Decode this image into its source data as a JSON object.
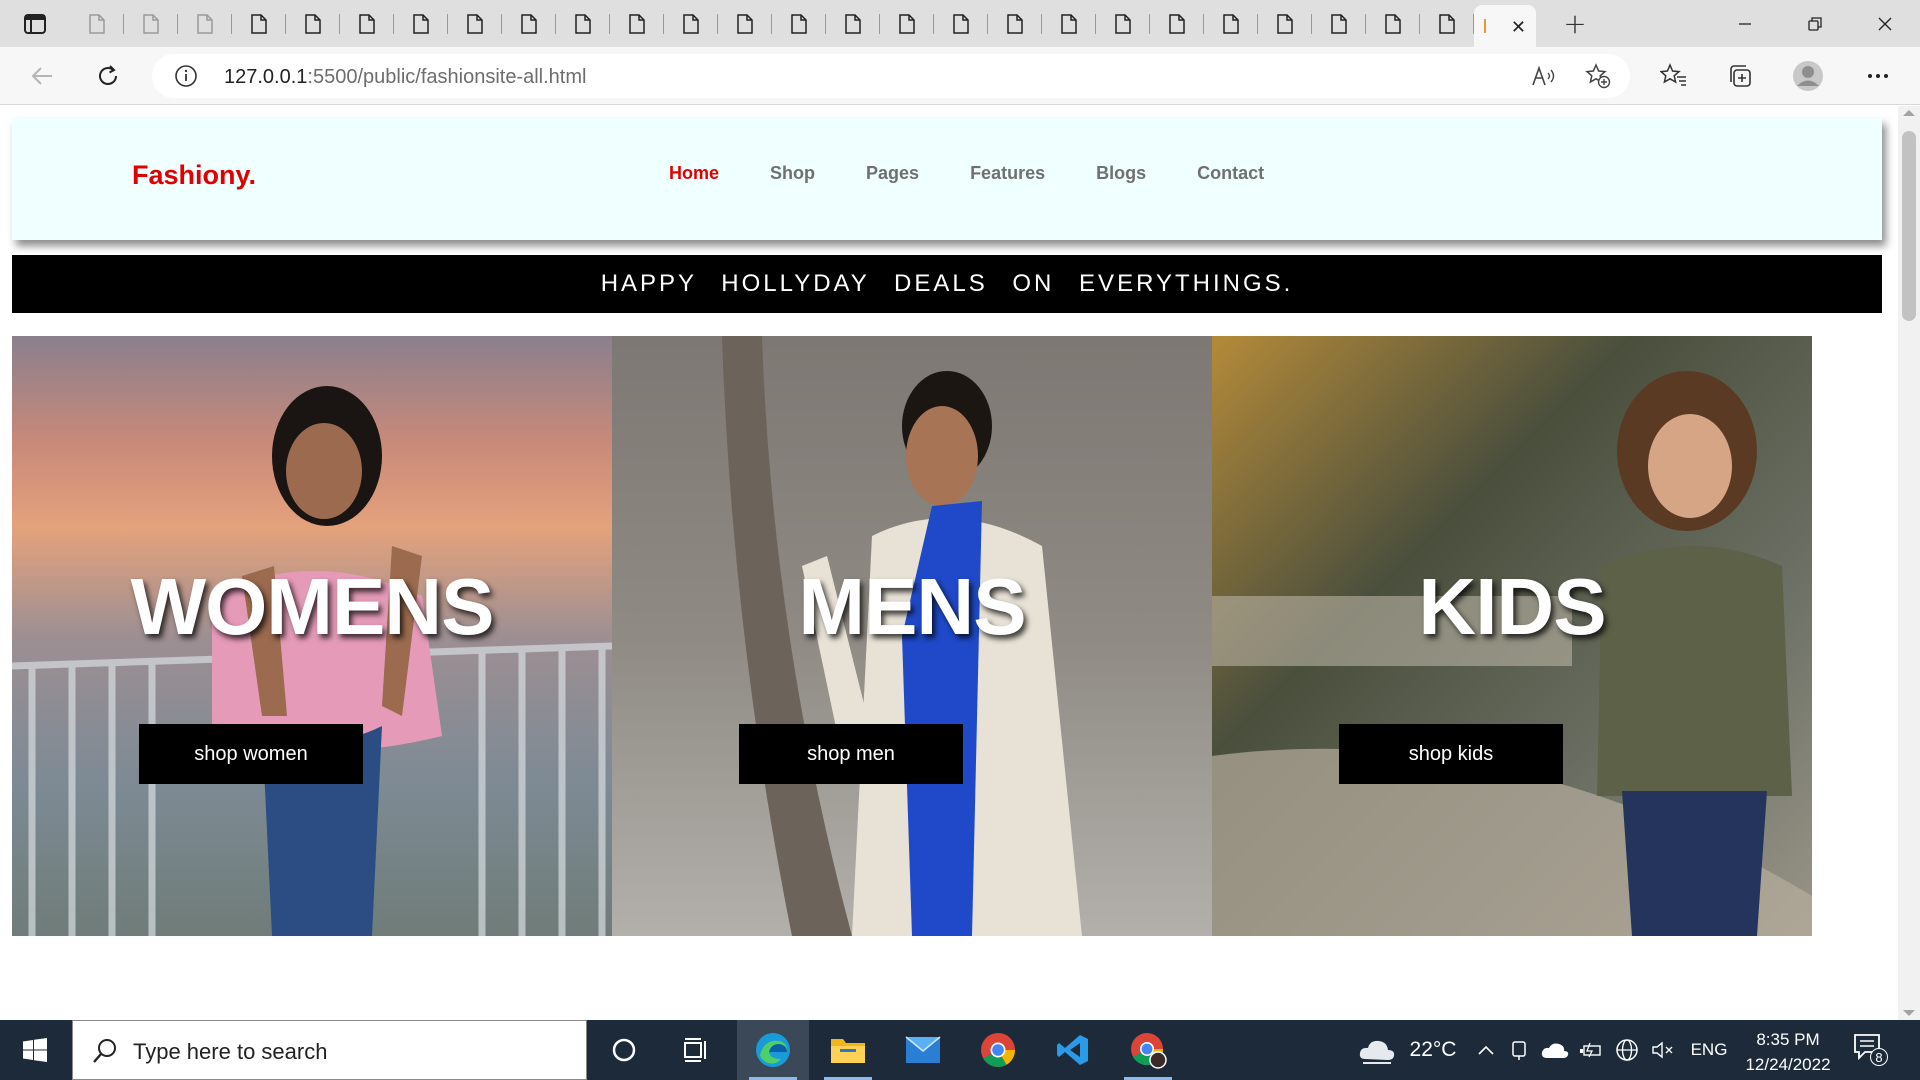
{
  "browser": {
    "tab_count_icons": 26,
    "active_tab_close": "✕",
    "url_host": "127.0.0.1",
    "url_path": ":5500/public/fashionsite-all.html"
  },
  "site": {
    "logo": "Fashiony.",
    "nav": [
      {
        "label": "Home",
        "current": true
      },
      {
        "label": "Shop"
      },
      {
        "label": "Pages"
      },
      {
        "label": "Features"
      },
      {
        "label": "Blogs"
      },
      {
        "label": "Contact"
      }
    ],
    "promo": "HAPPY HOLLYDAY DEALS ON EVERYTHINGS.",
    "categories": [
      {
        "title": "WOMENS",
        "button": "shop women"
      },
      {
        "title": "MENS",
        "button": "shop men"
      },
      {
        "title": "KIDS",
        "button": "shop kids"
      }
    ],
    "colors": {
      "accent": "#e10000",
      "header_bg": "#f0ffff",
      "banner_bg": "#000000"
    }
  },
  "taskbar": {
    "search_placeholder": "Type here to search",
    "weather_temp": "22°C",
    "language": "ENG",
    "time": "8:35 PM",
    "date": "12/24/2022",
    "notification_count": "8"
  }
}
